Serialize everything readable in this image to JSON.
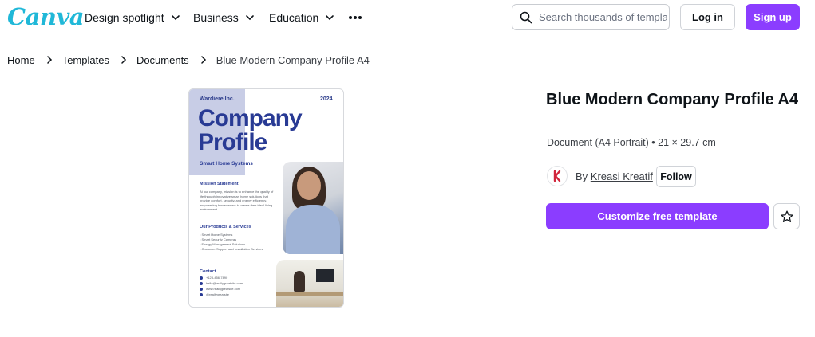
{
  "header": {
    "logo": "Canva",
    "nav": [
      {
        "label": "Design spotlight"
      },
      {
        "label": "Business"
      },
      {
        "label": "Education"
      }
    ],
    "search_placeholder": "Search thousands of templates",
    "login_label": "Log in",
    "signup_label": "Sign up"
  },
  "breadcrumb": {
    "items": [
      "Home",
      "Templates",
      "Documents"
    ],
    "current": "Blue Modern Company Profile A4"
  },
  "preview": {
    "company": "Wardiere Inc.",
    "year": "2024",
    "title_line1": "Company",
    "title_line2": "Profile",
    "subtitle": "Smart Home Systems",
    "mission_heading": "Mission Statement:",
    "mission_text": "At our company, mission is to enhance the quality of life through innovative smart home solutions that provide comfort, security, and energy efficiency, empowering homeowners to create their ideal living environment.",
    "products_heading": "Our Products & Services",
    "products": [
      "Smart Home Systems",
      "Smart Security Cameras",
      "Energy Management Solutions",
      "Customer Support and Installation Services"
    ],
    "contact_heading": "Contact",
    "contacts": [
      "+123-456-7890",
      "hello@reallygreatsite.com",
      "www.reallygreatsite.com",
      "@reallygreatsite"
    ]
  },
  "details": {
    "title": "Blue Modern Company Profile A4",
    "meta": "Document (A4 Portrait) • 21 × 29.7 cm",
    "by_prefix": "By",
    "author": "Kreasi Kreatif",
    "follow_label": "Follow",
    "customize_label": "Customize free template"
  },
  "colors": {
    "brand_purple": "#8b3dff",
    "logo_teal": "#20b8d8",
    "preview_blue": "#283a94"
  }
}
